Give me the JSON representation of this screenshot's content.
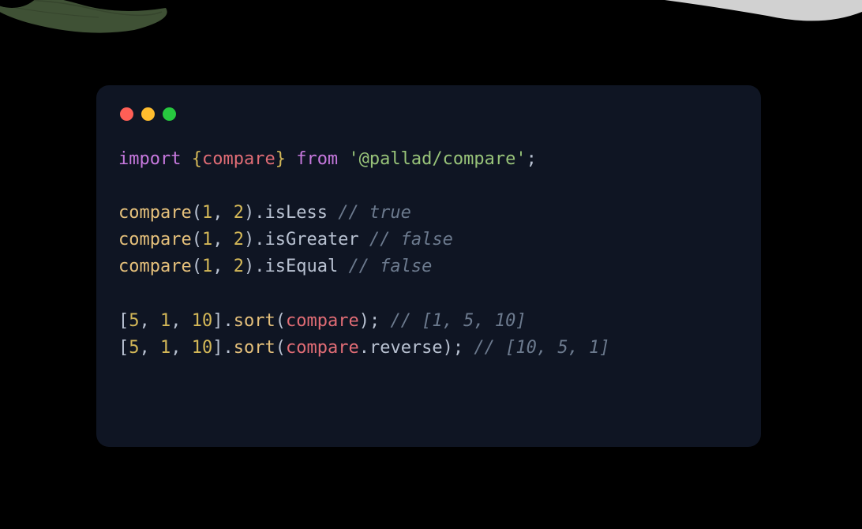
{
  "window": {
    "controls": {
      "close": "close",
      "minimize": "minimize",
      "maximize": "maximize"
    }
  },
  "code": {
    "line1": {
      "import": "import",
      "lbrace": " {",
      "compare": "compare",
      "rbrace": "}",
      "from": " from ",
      "package": "'@pallad/compare'",
      "semi": ";"
    },
    "line3": {
      "call": "compare",
      "lparen": "(",
      "n1": "1",
      "comma": ", ",
      "n2": "2",
      "rparen": ").",
      "prop": "isLess ",
      "comment": "// true"
    },
    "line4": {
      "call": "compare",
      "lparen": "(",
      "n1": "1",
      "comma": ", ",
      "n2": "2",
      "rparen": ").",
      "prop": "isGreater ",
      "comment": "// false"
    },
    "line5": {
      "call": "compare",
      "lparen": "(",
      "n1": "1",
      "comma": ", ",
      "n2": "2",
      "rparen": ").",
      "prop": "isEqual ",
      "comment": "// false"
    },
    "line7": {
      "lbrack": "[",
      "n1": "5",
      "c1": ", ",
      "n2": "1",
      "c2": ", ",
      "n3": "10",
      "rbrack": "].",
      "sort": "sort",
      "lparen": "(",
      "arg": "compare",
      "rparen": "); ",
      "comment": "// [1, 5, 10]"
    },
    "line8": {
      "lbrack": "[",
      "n1": "5",
      "c1": ", ",
      "n2": "1",
      "c2": ", ",
      "n3": "10",
      "rbrack": "].",
      "sort": "sort",
      "lparen": "(",
      "arg": "compare",
      "dot": ".",
      "prop": "reverse",
      "rparen": "); ",
      "comment": "// [10, 5, 1]"
    }
  }
}
